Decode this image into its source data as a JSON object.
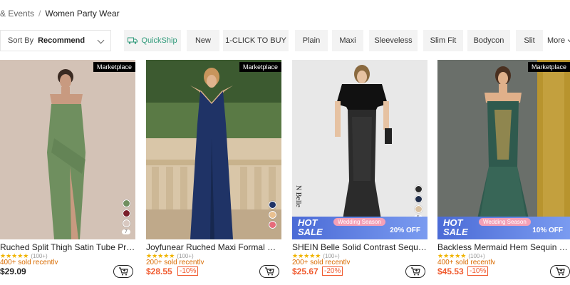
{
  "breadcrumb": {
    "parent": "& Events",
    "separator": "/",
    "current": "Women Party Wear"
  },
  "sort": {
    "label": "Sort By",
    "value": "Recommend"
  },
  "filters": [
    "QuickShip",
    "New",
    "1-CLICK TO BUY",
    "Plain",
    "Maxi",
    "Sleeveless",
    "Slim Fit",
    "Bodycon",
    "Slit"
  ],
  "more_label": "More",
  "colors": {
    "quickship": "#2f9a7a",
    "sale": "#f05a2e",
    "sold": "#d96b00",
    "stars": "#f0b400"
  },
  "products": [
    {
      "badge": "Marketplace",
      "title": "Ruched Split Thigh Satin Tube Prom D...",
      "stars": "★★★★★",
      "reviews": "(100+)",
      "sold": "400+ sold recently",
      "price": "$29.09",
      "discount": "",
      "swatch_count": "7",
      "promo": null
    },
    {
      "badge": "Marketplace",
      "title": "Joyfunear Ruched Maxi Formal Dress",
      "stars": "★★★★★",
      "reviews": "(100+)",
      "sold": "200+ sold recently",
      "price": "$28.55",
      "discount": "-10%",
      "swatch_count": "",
      "promo": null
    },
    {
      "badge": "",
      "title": "SHEIN Belle Solid Contrast Sequin Dr...",
      "stars": "★★★★★",
      "reviews": "(100+)",
      "sold": "200+ sold recently",
      "price": "$25.67",
      "discount": "-20%",
      "swatch_count": "5",
      "watermark": "N Belle",
      "promo": {
        "hot": "HOT",
        "sale": "SALE",
        "tag": "Wedding Season",
        "off": "20% OFF"
      }
    },
    {
      "badge": "Marketplace",
      "title": "Backless Mermaid Hem Sequin Prom ...",
      "stars": "★★★★★",
      "reviews": "(100+)",
      "sold": "400+ sold recently",
      "price": "$45.53",
      "discount": "-10%",
      "swatch_count": "",
      "promo": {
        "hot": "HOT",
        "sale": "SALE",
        "tag": "Wedding Season",
        "off": "10% OFF"
      }
    }
  ]
}
